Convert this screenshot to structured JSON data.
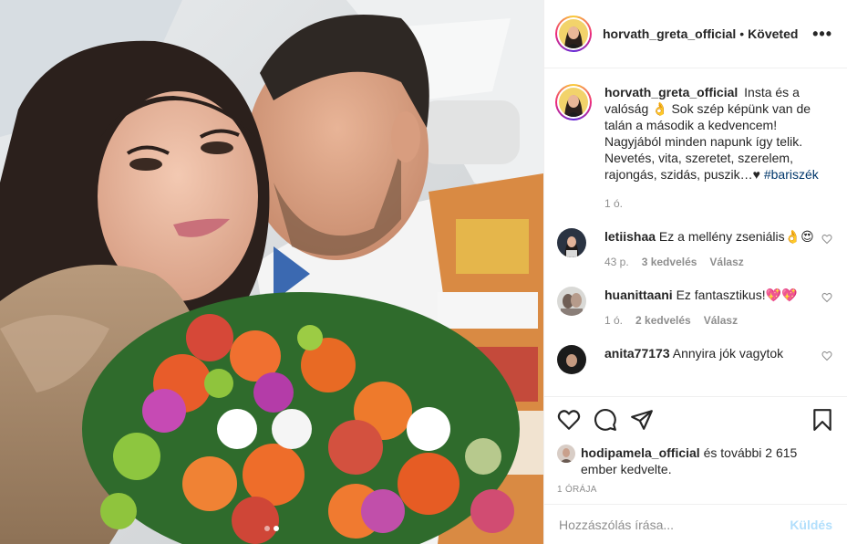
{
  "post": {
    "username": "horvath_greta_official",
    "follow_status": "Követed",
    "separator": "•",
    "more_label": "•••"
  },
  "caption": {
    "username": "horvath_greta_official",
    "text": "Insta és a valóság 👌 Sok szép képünk van de talán a második a kedvencem! Nagyjából minden napunk így telik. Nevetés, vita, szeretet, szerelem, rajongás, szidás, puszik…♥",
    "hashtag": "#bariszék",
    "time": "1 ó."
  },
  "comments": [
    {
      "username": "letiishaa",
      "text": "Ez a mellény zseniális👌😍",
      "age": "43 p.",
      "likes": "3 kedvelés",
      "reply": "Válasz"
    },
    {
      "username": "huanittaani",
      "text": "Ez fantasztikus!💖💖",
      "age": "1 ó.",
      "likes": "2 kedvelés",
      "reply": "Válasz"
    },
    {
      "username": "anita77173",
      "text": "Annyira jók vagytok",
      "age": "",
      "likes": "",
      "reply": ""
    }
  ],
  "likes": {
    "username": "hodipamela_official",
    "rest": "és további 2 615 ember kedvelte."
  },
  "post_age": "1 ÓRÁJA",
  "comment_box": {
    "placeholder": "Hozzászólás írása...",
    "post_label": "Küldés"
  },
  "colors": {
    "text": "#262626",
    "secondary": "#8e8e8e",
    "link": "#00376b",
    "post_button_disabled": "#b2dffc",
    "border": "#efefef"
  },
  "icons": [
    "more-options-icon",
    "heart-icon",
    "comment-icon",
    "share-icon",
    "bookmark-icon",
    "small-heart-icon"
  ],
  "carousel": {
    "slides": 2,
    "active": 2
  }
}
